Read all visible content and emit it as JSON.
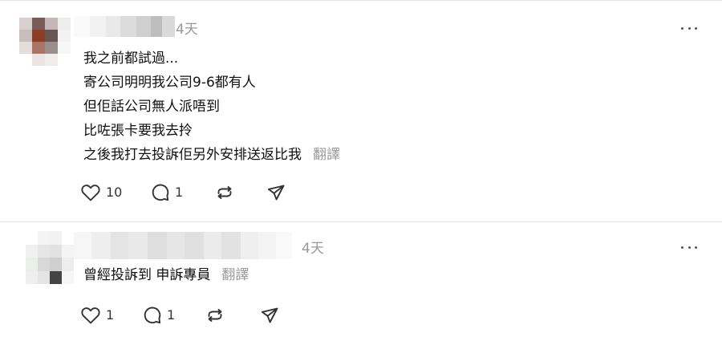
{
  "posts": [
    {
      "timestamp": "4天",
      "body_lines": [
        "我之前都試過...",
        "寄公司明明我公司9-6都有人",
        "但佢話公司無人派唔到",
        "比咗張卡要我去拎",
        "之後我打去投訴佢另外安排送返比我"
      ],
      "translate_label": "翻譯",
      "likes": "10",
      "replies": "1"
    },
    {
      "timestamp": "4天",
      "body_lines": [
        "曾經投訴到 申訴專員"
      ],
      "translate_label": "翻譯",
      "likes": "1",
      "replies": "1"
    }
  ],
  "icons": {
    "like": "heart-icon",
    "reply": "comment-icon",
    "repost": "repost-icon",
    "share": "share-icon",
    "more": "more-options-icon"
  },
  "colors": {
    "text": "#111111",
    "muted": "#999999",
    "icon": "#333333",
    "divider": "#e6e6e6"
  }
}
